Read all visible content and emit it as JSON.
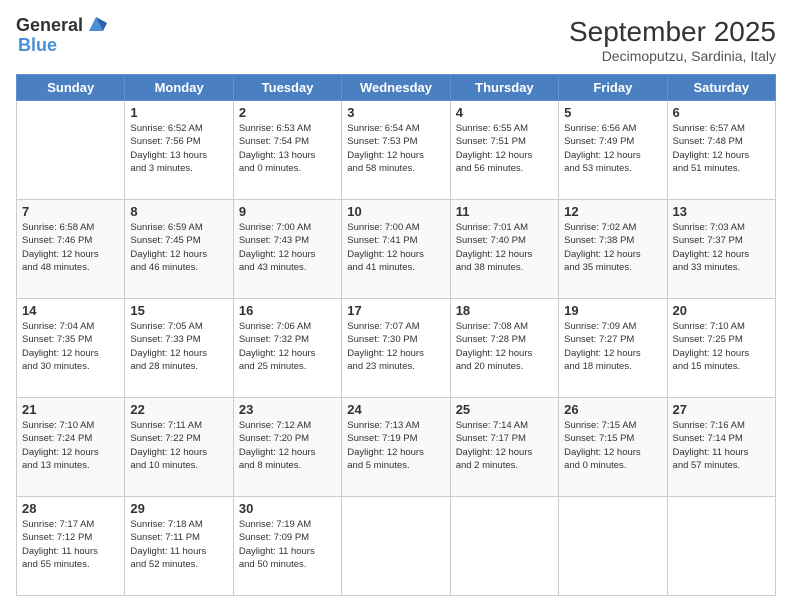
{
  "header": {
    "logo_general": "General",
    "logo_blue": "Blue",
    "month_year": "September 2025",
    "location": "Decimoputzu, Sardinia, Italy"
  },
  "weekdays": [
    "Sunday",
    "Monday",
    "Tuesday",
    "Wednesday",
    "Thursday",
    "Friday",
    "Saturday"
  ],
  "weeks": [
    [
      {
        "day": "",
        "info": ""
      },
      {
        "day": "1",
        "info": "Sunrise: 6:52 AM\nSunset: 7:56 PM\nDaylight: 13 hours\nand 3 minutes."
      },
      {
        "day": "2",
        "info": "Sunrise: 6:53 AM\nSunset: 7:54 PM\nDaylight: 13 hours\nand 0 minutes."
      },
      {
        "day": "3",
        "info": "Sunrise: 6:54 AM\nSunset: 7:53 PM\nDaylight: 12 hours\nand 58 minutes."
      },
      {
        "day": "4",
        "info": "Sunrise: 6:55 AM\nSunset: 7:51 PM\nDaylight: 12 hours\nand 56 minutes."
      },
      {
        "day": "5",
        "info": "Sunrise: 6:56 AM\nSunset: 7:49 PM\nDaylight: 12 hours\nand 53 minutes."
      },
      {
        "day": "6",
        "info": "Sunrise: 6:57 AM\nSunset: 7:48 PM\nDaylight: 12 hours\nand 51 minutes."
      }
    ],
    [
      {
        "day": "7",
        "info": "Sunrise: 6:58 AM\nSunset: 7:46 PM\nDaylight: 12 hours\nand 48 minutes."
      },
      {
        "day": "8",
        "info": "Sunrise: 6:59 AM\nSunset: 7:45 PM\nDaylight: 12 hours\nand 46 minutes."
      },
      {
        "day": "9",
        "info": "Sunrise: 7:00 AM\nSunset: 7:43 PM\nDaylight: 12 hours\nand 43 minutes."
      },
      {
        "day": "10",
        "info": "Sunrise: 7:00 AM\nSunset: 7:41 PM\nDaylight: 12 hours\nand 41 minutes."
      },
      {
        "day": "11",
        "info": "Sunrise: 7:01 AM\nSunset: 7:40 PM\nDaylight: 12 hours\nand 38 minutes."
      },
      {
        "day": "12",
        "info": "Sunrise: 7:02 AM\nSunset: 7:38 PM\nDaylight: 12 hours\nand 35 minutes."
      },
      {
        "day": "13",
        "info": "Sunrise: 7:03 AM\nSunset: 7:37 PM\nDaylight: 12 hours\nand 33 minutes."
      }
    ],
    [
      {
        "day": "14",
        "info": "Sunrise: 7:04 AM\nSunset: 7:35 PM\nDaylight: 12 hours\nand 30 minutes."
      },
      {
        "day": "15",
        "info": "Sunrise: 7:05 AM\nSunset: 7:33 PM\nDaylight: 12 hours\nand 28 minutes."
      },
      {
        "day": "16",
        "info": "Sunrise: 7:06 AM\nSunset: 7:32 PM\nDaylight: 12 hours\nand 25 minutes."
      },
      {
        "day": "17",
        "info": "Sunrise: 7:07 AM\nSunset: 7:30 PM\nDaylight: 12 hours\nand 23 minutes."
      },
      {
        "day": "18",
        "info": "Sunrise: 7:08 AM\nSunset: 7:28 PM\nDaylight: 12 hours\nand 20 minutes."
      },
      {
        "day": "19",
        "info": "Sunrise: 7:09 AM\nSunset: 7:27 PM\nDaylight: 12 hours\nand 18 minutes."
      },
      {
        "day": "20",
        "info": "Sunrise: 7:10 AM\nSunset: 7:25 PM\nDaylight: 12 hours\nand 15 minutes."
      }
    ],
    [
      {
        "day": "21",
        "info": "Sunrise: 7:10 AM\nSunset: 7:24 PM\nDaylight: 12 hours\nand 13 minutes."
      },
      {
        "day": "22",
        "info": "Sunrise: 7:11 AM\nSunset: 7:22 PM\nDaylight: 12 hours\nand 10 minutes."
      },
      {
        "day": "23",
        "info": "Sunrise: 7:12 AM\nSunset: 7:20 PM\nDaylight: 12 hours\nand 8 minutes."
      },
      {
        "day": "24",
        "info": "Sunrise: 7:13 AM\nSunset: 7:19 PM\nDaylight: 12 hours\nand 5 minutes."
      },
      {
        "day": "25",
        "info": "Sunrise: 7:14 AM\nSunset: 7:17 PM\nDaylight: 12 hours\nand 2 minutes."
      },
      {
        "day": "26",
        "info": "Sunrise: 7:15 AM\nSunset: 7:15 PM\nDaylight: 12 hours\nand 0 minutes."
      },
      {
        "day": "27",
        "info": "Sunrise: 7:16 AM\nSunset: 7:14 PM\nDaylight: 11 hours\nand 57 minutes."
      }
    ],
    [
      {
        "day": "28",
        "info": "Sunrise: 7:17 AM\nSunset: 7:12 PM\nDaylight: 11 hours\nand 55 minutes."
      },
      {
        "day": "29",
        "info": "Sunrise: 7:18 AM\nSunset: 7:11 PM\nDaylight: 11 hours\nand 52 minutes."
      },
      {
        "day": "30",
        "info": "Sunrise: 7:19 AM\nSunset: 7:09 PM\nDaylight: 11 hours\nand 50 minutes."
      },
      {
        "day": "",
        "info": ""
      },
      {
        "day": "",
        "info": ""
      },
      {
        "day": "",
        "info": ""
      },
      {
        "day": "",
        "info": ""
      }
    ]
  ]
}
